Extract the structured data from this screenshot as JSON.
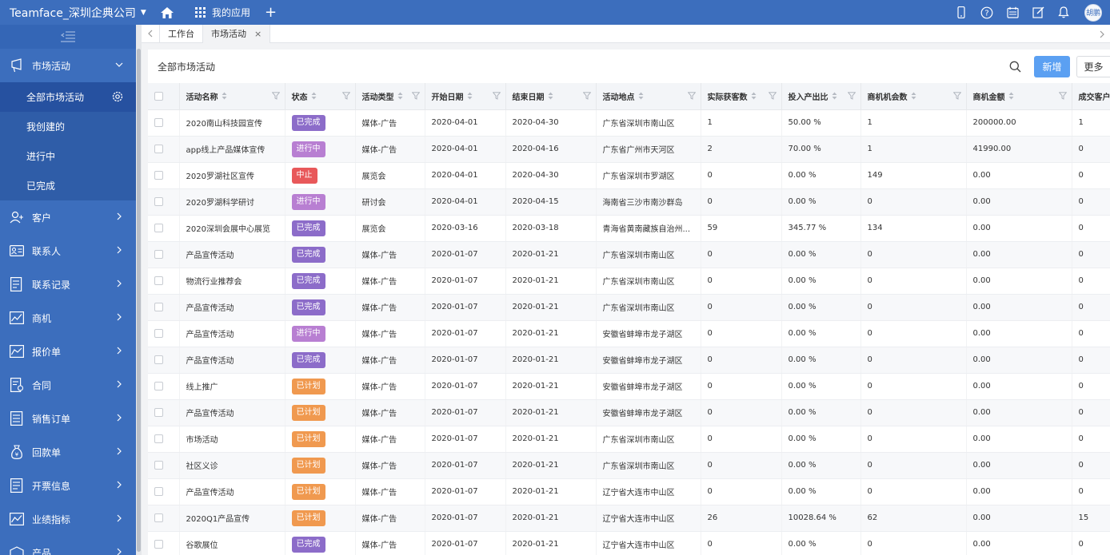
{
  "topbar": {
    "brand": "Teamface_深圳企典公司",
    "my_apps": "我的应用",
    "avatar_text": "胡鹏"
  },
  "sidebar": {
    "groups": [
      {
        "label": "市场活动",
        "icon": "megaphone-icon",
        "expanded": true
      },
      {
        "label": "客户",
        "icon": "customer-icon"
      },
      {
        "label": "联系人",
        "icon": "contact-card-icon"
      },
      {
        "label": "联系记录",
        "icon": "record-icon"
      },
      {
        "label": "商机",
        "icon": "opportunity-chart-icon"
      },
      {
        "label": "报价单",
        "icon": "quote-chart-icon"
      },
      {
        "label": "合同",
        "icon": "contract-icon"
      },
      {
        "label": "销售订单",
        "icon": "order-icon"
      },
      {
        "label": "回款单",
        "icon": "payment-bag-icon"
      },
      {
        "label": "开票信息",
        "icon": "invoice-icon"
      },
      {
        "label": "业绩指标",
        "icon": "performance-chart-icon"
      },
      {
        "label": "产品",
        "icon": "product-icon"
      }
    ],
    "sub_items": [
      {
        "label": "全部市场活动",
        "active": true
      },
      {
        "label": "我创建的"
      },
      {
        "label": "进行中"
      },
      {
        "label": "已完成"
      }
    ]
  },
  "tabs": [
    {
      "label": "工作台"
    },
    {
      "label": "市场活动",
      "active": true
    }
  ],
  "panel": {
    "title": "全部市场活动",
    "new_button": "新增",
    "more_button": "更多"
  },
  "table": {
    "columns": [
      "活动名称",
      "状态",
      "活动类型",
      "开始日期",
      "结束日期",
      "活动地点",
      "实际获客数",
      "投入产出比",
      "商机机会数",
      "商机金额",
      "成交客户"
    ],
    "rows": [
      {
        "name": "2020南山科技园宣传",
        "status": "已完成",
        "status_kind": "done",
        "type": "媒体-广告",
        "start": "2020-04-01",
        "end": "2020-04-30",
        "location": "广东省深圳市南山区",
        "customers": "1",
        "roi": "50.00 %",
        "opps": "1",
        "amount": "200000.00",
        "deals": "1"
      },
      {
        "name": "app线上产品媒体宣传",
        "status": "进行中",
        "status_kind": "prog",
        "type": "媒体-广告",
        "start": "2020-04-01",
        "end": "2020-04-16",
        "location": "广东省广州市天河区",
        "customers": "2",
        "roi": "70.00 %",
        "opps": "1",
        "amount": "41990.00",
        "deals": "0"
      },
      {
        "name": "2020罗湖社区宣传",
        "status": "中止",
        "status_kind": "stop",
        "type": "展览会",
        "start": "2020-04-01",
        "end": "2020-04-30",
        "location": "广东省深圳市罗湖区",
        "customers": "0",
        "roi": "0.00 %",
        "opps": "149",
        "amount": "0.00",
        "deals": "0"
      },
      {
        "name": "2020罗湖科学研讨",
        "status": "进行中",
        "status_kind": "prog",
        "type": "研讨会",
        "start": "2020-04-01",
        "end": "2020-04-15",
        "location": "海南省三沙市南沙群岛",
        "customers": "0",
        "roi": "0.00 %",
        "opps": "0",
        "amount": "0.00",
        "deals": "0"
      },
      {
        "name": "2020深圳会展中心展览",
        "status": "已完成",
        "status_kind": "done",
        "type": "展览会",
        "start": "2020-03-16",
        "end": "2020-03-18",
        "location": "青海省黄南藏族自治州...",
        "customers": "59",
        "roi": "345.77 %",
        "opps": "134",
        "amount": "0.00",
        "deals": "0"
      },
      {
        "name": "产品宣传活动",
        "status": "已完成",
        "status_kind": "done",
        "type": "媒体-广告",
        "start": "2020-01-07",
        "end": "2020-01-21",
        "location": "广东省深圳市南山区",
        "customers": "0",
        "roi": "0.00 %",
        "opps": "0",
        "amount": "0.00",
        "deals": "0"
      },
      {
        "name": "物流行业推荐会",
        "status": "已完成",
        "status_kind": "done",
        "type": "媒体-广告",
        "start": "2020-01-07",
        "end": "2020-01-21",
        "location": "广东省深圳市南山区",
        "customers": "0",
        "roi": "0.00 %",
        "opps": "0",
        "amount": "0.00",
        "deals": "0"
      },
      {
        "name": "产品宣传活动",
        "status": "已完成",
        "status_kind": "done",
        "type": "媒体-广告",
        "start": "2020-01-07",
        "end": "2020-01-21",
        "location": "广东省深圳市南山区",
        "customers": "0",
        "roi": "0.00 %",
        "opps": "0",
        "amount": "0.00",
        "deals": "0"
      },
      {
        "name": "产品宣传活动",
        "status": "进行中",
        "status_kind": "prog",
        "type": "媒体-广告",
        "start": "2020-01-07",
        "end": "2020-01-21",
        "location": "安徽省蚌埠市龙子湖区",
        "customers": "0",
        "roi": "0.00 %",
        "opps": "0",
        "amount": "0.00",
        "deals": "0"
      },
      {
        "name": "产品宣传活动",
        "status": "已完成",
        "status_kind": "done",
        "type": "媒体-广告",
        "start": "2020-01-07",
        "end": "2020-01-21",
        "location": "安徽省蚌埠市龙子湖区",
        "customers": "0",
        "roi": "0.00 %",
        "opps": "0",
        "amount": "0.00",
        "deals": "0"
      },
      {
        "name": "线上推广",
        "status": "已计划",
        "status_kind": "plan",
        "type": "媒体-广告",
        "start": "2020-01-07",
        "end": "2020-01-21",
        "location": "安徽省蚌埠市龙子湖区",
        "customers": "0",
        "roi": "0.00 %",
        "opps": "0",
        "amount": "0.00",
        "deals": "0"
      },
      {
        "name": "产品宣传活动",
        "status": "已计划",
        "status_kind": "plan",
        "type": "媒体-广告",
        "start": "2020-01-07",
        "end": "2020-01-21",
        "location": "安徽省蚌埠市龙子湖区",
        "customers": "0",
        "roi": "0.00 %",
        "opps": "0",
        "amount": "0.00",
        "deals": "0"
      },
      {
        "name": "市场活动",
        "status": "已计划",
        "status_kind": "plan",
        "type": "媒体-广告",
        "start": "2020-01-07",
        "end": "2020-01-21",
        "location": "广东省深圳市南山区",
        "customers": "0",
        "roi": "0.00 %",
        "opps": "0",
        "amount": "0.00",
        "deals": "0"
      },
      {
        "name": "社区义诊",
        "status": "已计划",
        "status_kind": "plan",
        "type": "媒体-广告",
        "start": "2020-01-07",
        "end": "2020-01-21",
        "location": "广东省深圳市南山区",
        "customers": "0",
        "roi": "0.00 %",
        "opps": "0",
        "amount": "0.00",
        "deals": "0"
      },
      {
        "name": "产品宣传活动",
        "status": "已计划",
        "status_kind": "plan",
        "type": "媒体-广告",
        "start": "2020-01-07",
        "end": "2020-01-21",
        "location": "辽宁省大连市中山区",
        "customers": "0",
        "roi": "0.00 %",
        "opps": "0",
        "amount": "0.00",
        "deals": "0"
      },
      {
        "name": "2020Q1产品宣传",
        "status": "已计划",
        "status_kind": "plan",
        "type": "媒体-广告",
        "start": "2020-01-07",
        "end": "2020-01-21",
        "location": "辽宁省大连市中山区",
        "customers": "26",
        "roi": "10028.64 %",
        "opps": "62",
        "amount": "0.00",
        "deals": "15"
      },
      {
        "name": "谷歌展位",
        "status": "已完成",
        "status_kind": "done",
        "type": "媒体-广告",
        "start": "2020-01-07",
        "end": "2020-01-21",
        "location": "辽宁省大连市中山区",
        "customers": "0",
        "roi": "0.00 %",
        "opps": "0",
        "amount": "0.00",
        "deals": "0"
      }
    ]
  },
  "colors": {
    "primary": "#3c6ebd",
    "done": "#8c6cc9",
    "in_progress": "#b87fd2",
    "stopped": "#e8585a",
    "planned": "#f0994f"
  }
}
